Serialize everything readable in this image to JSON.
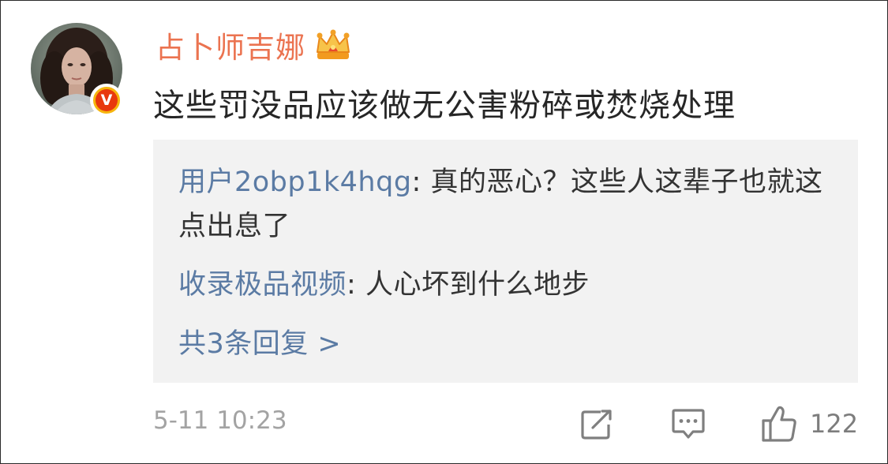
{
  "comment": {
    "username": "占卜师吉娜",
    "text": "这些罚没品应该做无公害粉碎或焚烧处理",
    "verified_badge": "V",
    "badge_icon": "crown-icon",
    "avatar_icon": "user-avatar"
  },
  "replies": [
    {
      "user": "用户2obp1k4hqg",
      "separator": ": ",
      "text": "真的恶心？这些人这辈子也就这点出息了"
    },
    {
      "user": "收录极品视频",
      "separator": ": ",
      "text": "人心坏到什么地步"
    }
  ],
  "more_replies_label": "共3条回复 >",
  "footer": {
    "timestamp": "5-11 10:23",
    "like_count": "122",
    "icons": [
      "share-icon",
      "comment-icon",
      "like-icon"
    ]
  },
  "colors": {
    "username": "#eb7350",
    "link": "#5b7ba4",
    "text": "#262626",
    "meta": "#a3a3a3",
    "reply_bg": "#f2f2f2",
    "badge_outer": "#f6b50e",
    "badge_inner": "#e8380d"
  }
}
